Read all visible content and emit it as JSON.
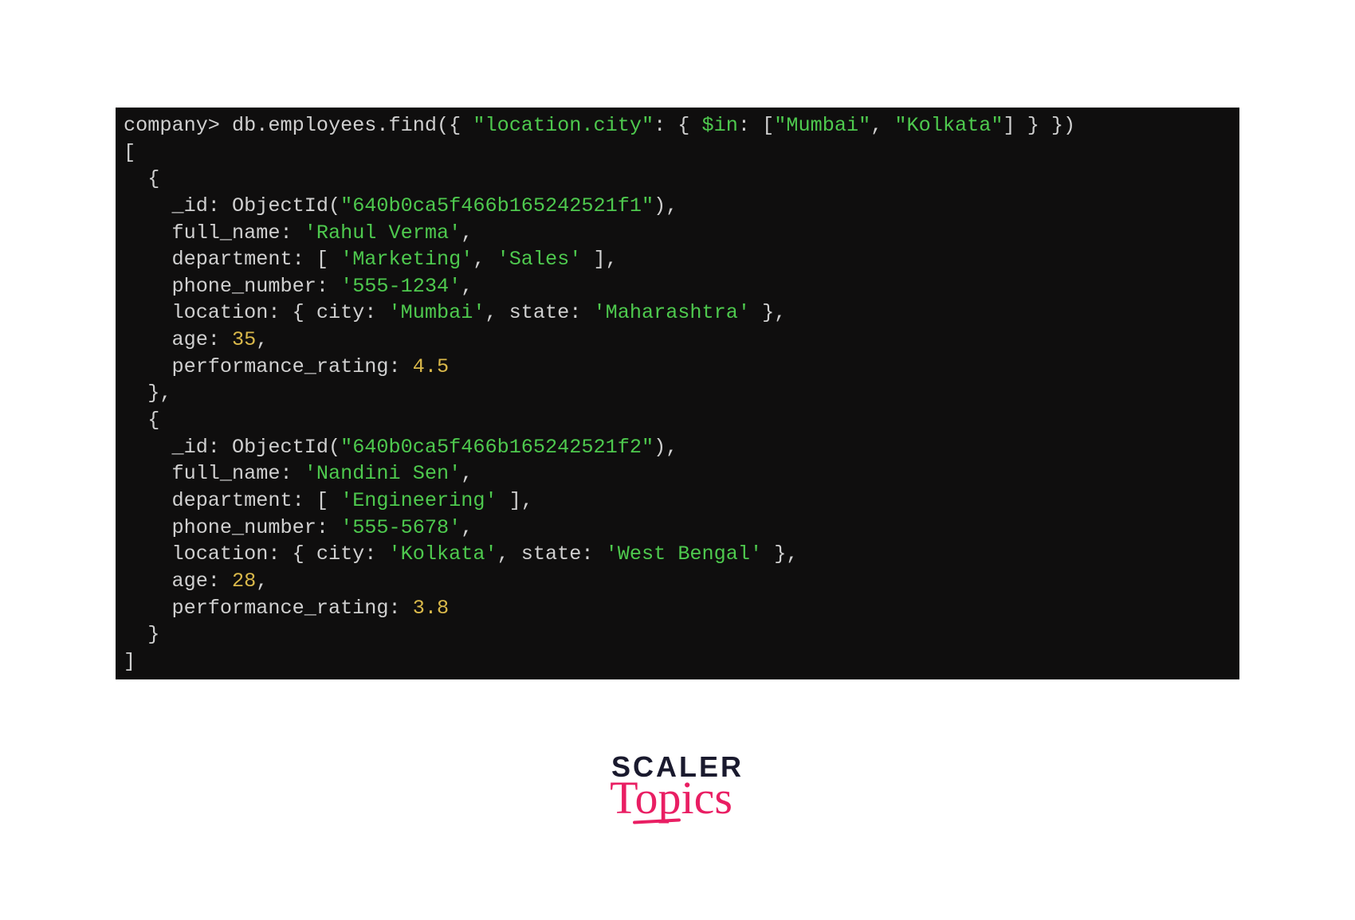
{
  "terminal": {
    "prompt": "company>",
    "command_pre": " db.employees.find({ ",
    "field_key": "\"location.city\"",
    "mid1": ": { ",
    "operator": "$in",
    "mid2": ": [",
    "val1": "\"Mumbai\"",
    "comma1": ", ",
    "val2": "\"Kolkata\"",
    "command_end": "] } })"
  },
  "output": {
    "open_bracket": "[",
    "close_bracket": "]",
    "open_brace": "  {",
    "close_brace_comma": "  },",
    "close_brace": "  }",
    "records": [
      {
        "id_label": "    _id: ObjectId(",
        "id_value": "\"640b0ca5f466b165242521f1\"",
        "id_close": "),",
        "fullname_label": "    full_name: ",
        "fullname_value": "'Rahul Verma'",
        "comma": ",",
        "dept_label": "    department: [ ",
        "dept_val1": "'Marketing'",
        "dept_sep": ", ",
        "dept_val2": "'Sales'",
        "dept_close": " ],",
        "phone_label": "    phone_number: ",
        "phone_value": "'555-1234'",
        "loc_label": "    location: { city: ",
        "loc_city": "'Mumbai'",
        "loc_mid": ", state: ",
        "loc_state": "'Maharashtra'",
        "loc_close": " },",
        "age_label": "    age: ",
        "age_value": "35",
        "perf_label": "    performance_rating: ",
        "perf_value": "4.5"
      },
      {
        "id_label": "    _id: ObjectId(",
        "id_value": "\"640b0ca5f466b165242521f2\"",
        "id_close": "),",
        "fullname_label": "    full_name: ",
        "fullname_value": "'Nandini Sen'",
        "comma": ",",
        "dept_label": "    department: [ ",
        "dept_val1": "'Engineering'",
        "dept_close": " ],",
        "phone_label": "    phone_number: ",
        "phone_value": "'555-5678'",
        "loc_label": "    location: { city: ",
        "loc_city": "'Kolkata'",
        "loc_mid": ", state: ",
        "loc_state": "'West Bengal'",
        "loc_close": " },",
        "age_label": "    age: ",
        "age_value": "28",
        "perf_label": "    performance_rating: ",
        "perf_value": "3.8"
      }
    ]
  },
  "logo": {
    "line1": "SCALER",
    "line2": "Topics"
  }
}
